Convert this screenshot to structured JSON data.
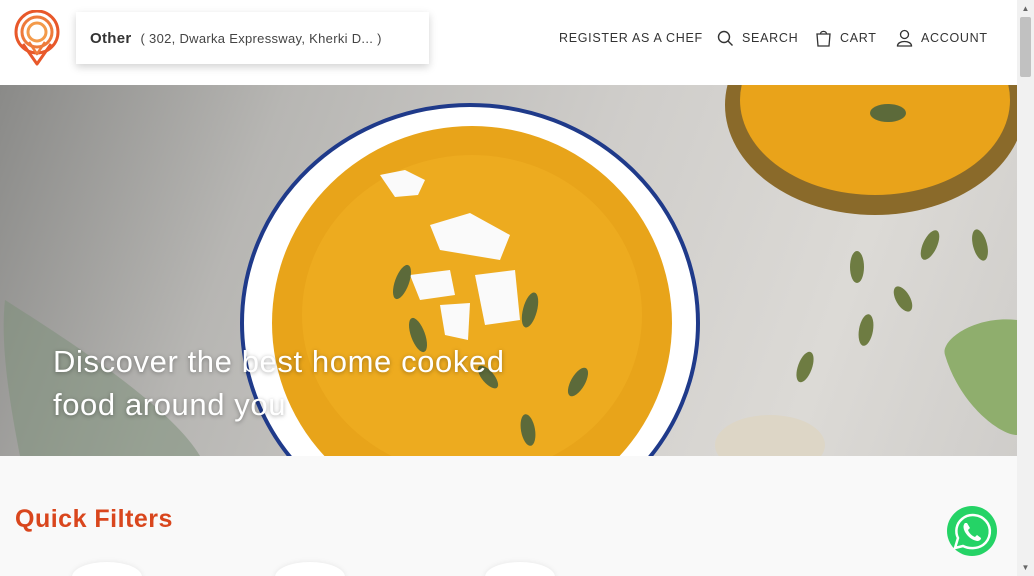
{
  "header": {
    "location": {
      "type": "Other",
      "address": "( 302, Dwarka Expressway, Kherki D... )"
    },
    "nav": {
      "register": "REGISTER AS A CHEF",
      "search": "SEARCH",
      "cart": "CART",
      "account": "ACCOUNT"
    }
  },
  "hero": {
    "title_line1": "Discover the best home cooked",
    "title_line2": "food around you"
  },
  "quick_filters": {
    "title": "Quick Filters"
  },
  "colors": {
    "brand_orange": "#e8582a",
    "title_orange": "#d9461d",
    "whatsapp_green": "#25d366"
  }
}
